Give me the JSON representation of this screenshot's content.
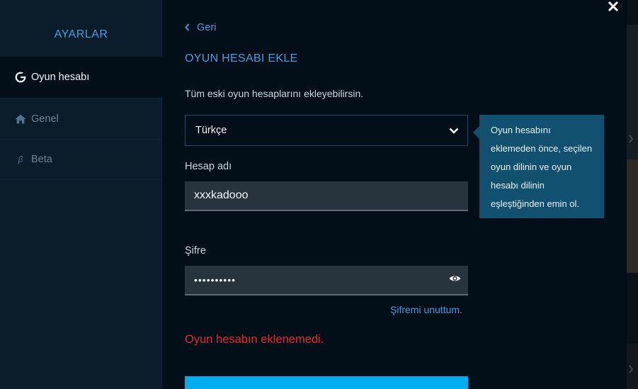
{
  "sidebar": {
    "title": "AYARLAR",
    "items": [
      {
        "label": "Oyun hesabı",
        "icon": "g-logo-icon",
        "active": true
      },
      {
        "label": "Genel",
        "icon": "home-icon",
        "active": false
      },
      {
        "label": "Beta",
        "icon": "beta-icon",
        "active": false
      }
    ],
    "beta_symbol": "β"
  },
  "main": {
    "back_label": "Geri",
    "title": "OYUN HESABI EKLE",
    "description": "Tüm eski oyun hesaplarını ekleyebilirsin.",
    "language_select": {
      "value": "Türkçe"
    },
    "tooltip": "Oyun hesabını eklemeden önce, seçilen oyun dilinin ve oyun hesabı dilinin eşleştiğinden emin ol.",
    "account_name": {
      "label": "Hesap adı",
      "value": "xxxkadooo"
    },
    "password": {
      "label": "Şifre",
      "value": "••••••••••"
    },
    "forgot_password": "Şifremi unuttum.",
    "error": "Oyun hesabın eklenemedi.",
    "submit_label": ""
  },
  "colors": {
    "accent": "#4d9be0",
    "button": "#00aeef",
    "error": "#e8282f",
    "tooltip_bg": "#125070",
    "background": "#020f18",
    "sidebar_bg": "#0b1d2a"
  }
}
